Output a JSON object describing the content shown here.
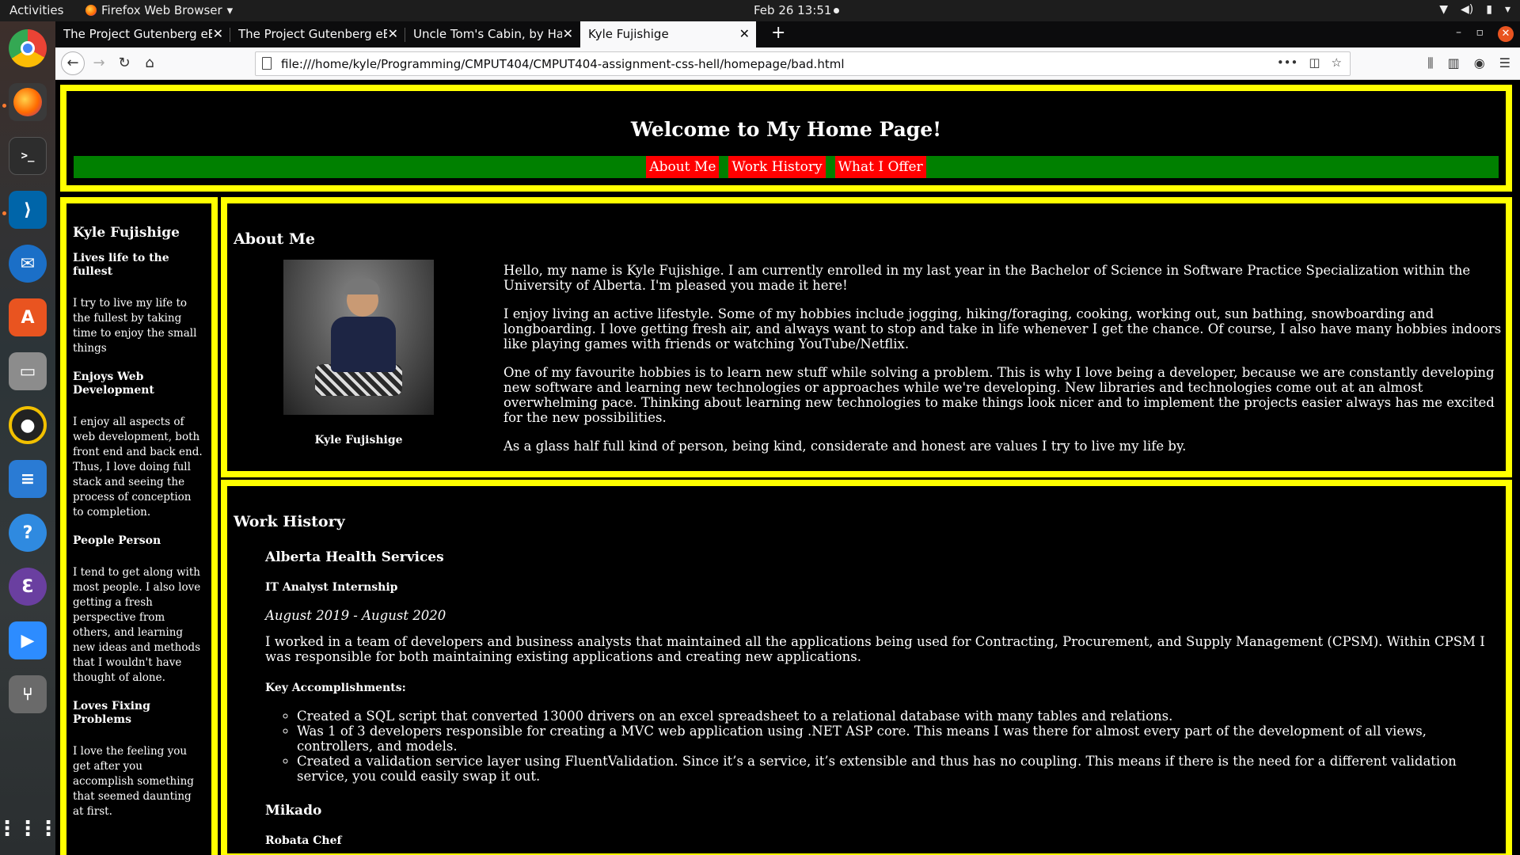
{
  "topbar": {
    "activities": "Activities",
    "app_name": "Firefox Web Browser",
    "clock": "Feb 26  13:51"
  },
  "dock": {
    "items": [
      "chrome-icon",
      "firefox-icon",
      "terminal-icon",
      "vscode-icon",
      "thunderbird-icon",
      "software-center-icon",
      "files-icon",
      "rhythmbox-icon",
      "libreoffice-writer-icon",
      "help-icon",
      "emacs-icon",
      "zoom-icon",
      "usb-drive-icon",
      "app-grid-icon"
    ]
  },
  "browser": {
    "tabs": [
      {
        "title": "The Project Gutenberg eBoo"
      },
      {
        "title": "The Project Gutenberg eBoo"
      },
      {
        "title": "Uncle Tom's Cabin, by Harrie"
      },
      {
        "title": "Kyle Fujishige"
      }
    ],
    "url": "file:///home/kyle/Programming/CMPUT404/CMPUT404-assignment-css-hell/homepage/bad.html"
  },
  "site": {
    "title": "Welcome to My Home Page!",
    "nav": [
      "About Me",
      "Work History",
      "What I Offer"
    ],
    "sidebar": {
      "name": "Kyle Fujishige",
      "sections": [
        {
          "heading": "Lives life to the fullest",
          "text": "I try to live my life to the fullest by taking time to enjoy the small things"
        },
        {
          "heading": "Enjoys Web Development",
          "text": "I enjoy all aspects of web development, both front end and back end. Thus, I love doing full stack and seeing the process of conception to completion."
        },
        {
          "heading": "People Person",
          "text": "I tend to get along with most people. I also love getting a fresh perspective from others, and learning new ideas and methods that I wouldn't have thought of alone."
        },
        {
          "heading": "Loves Fixing Problems",
          "text": "I love the feeling you get after you accomplish something that seemed daunting at first."
        }
      ]
    },
    "about": {
      "heading": "About Me",
      "caption": "Kyle Fujishige",
      "paragraphs": [
        "Hello, my name is Kyle Fujishige. I am currently enrolled in my last year in the Bachelor of Science in Software Practice Specialization within the University of Alberta. I'm pleased you made it here!",
        "I enjoy living an active lifestyle. Some of my hobbies include jogging, hiking/foraging, cooking, working out, sun bathing, snowboarding and longboarding. I love getting fresh air, and always want to stop and take in life whenever I get the chance. Of course, I also have many hobbies indoors like playing games with friends or watching YouTube/Netflix.",
        "One of my favourite hobbies is to learn new stuff while solving a problem. This is why I love being a developer, because we are constantly developing new software and learning new technologies or approaches while we're developing. New libraries and technologies come out at an almost overwhelming pace. Thinking about learning new technologies to make things look nicer and to implement the projects easier always has me excited for the new possibilities.",
        "As a glass half full kind of person, being kind, considerate and honest are values I try to live my life by."
      ]
    },
    "work": {
      "heading": "Work History",
      "jobs": [
        {
          "company": "Alberta Health Services",
          "role": "IT Analyst Internship",
          "dates": "August 2019 - August 2020",
          "description": "I worked in a team of developers and business analysts that maintained all the applications being used for Contracting, Procurement, and Supply Management (CPSM). Within CPSM I was responsible for both maintaining existing applications and creating new applications.",
          "accomplishments_heading": "Key Accomplishments:",
          "accomplishments": [
            "Created a SQL script that converted 13000 drivers on an excel spreadsheet to a relational database with many tables and relations.",
            "Was 1 of 3 developers responsible for creating a MVC web application using .NET ASP core. This means I was there for almost every part of the development of all views, controllers, and models.",
            "Created a validation service layer using FluentValidation. Since it’s a service, it’s extensible and thus has no coupling. This means if there is the need for a different validation service, you could easily swap it out."
          ]
        },
        {
          "company": "Mikado",
          "role": "Robata Chef"
        }
      ]
    }
  },
  "colors": {
    "border": "#ffff00",
    "nav_bg": "#008000",
    "nav_link_bg": "#ff0000",
    "page_bg": "#000000"
  }
}
